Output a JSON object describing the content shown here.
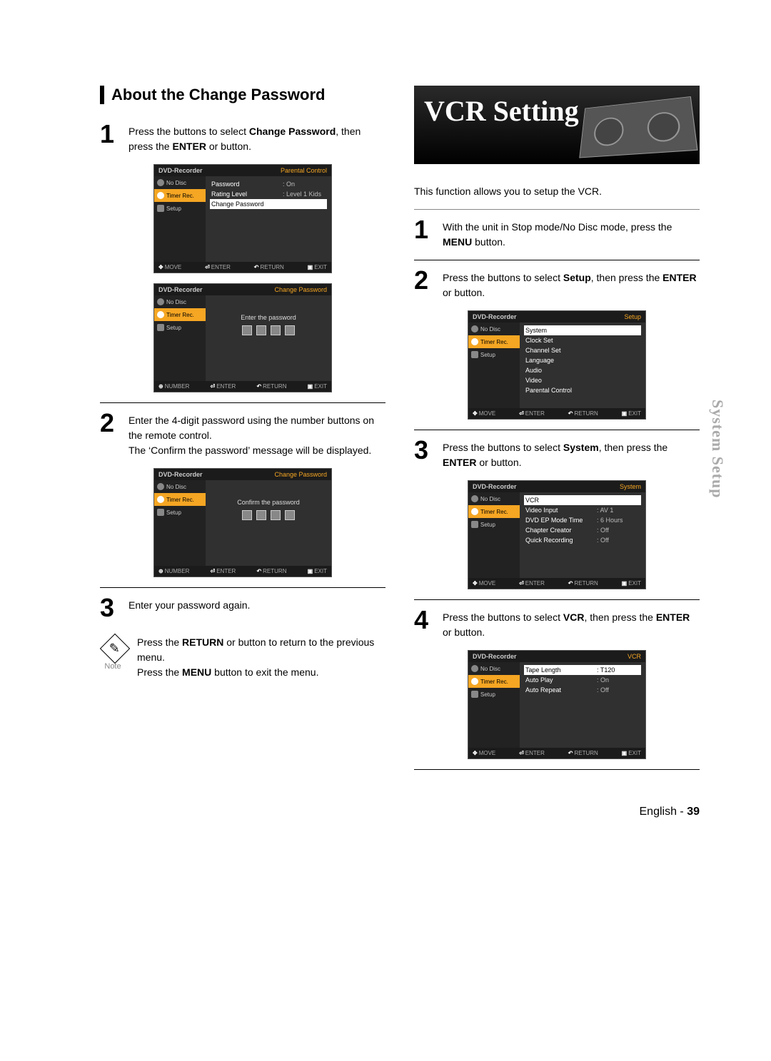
{
  "left": {
    "heading": "About the Change Password",
    "step1": {
      "t1": "Press the ",
      "t2": " buttons to select ",
      "bold1": "Change Password",
      "t3": ", then press the ",
      "bold2": "ENTER",
      "t4": " or ",
      "t5": " button."
    },
    "osd1": {
      "title": "DVD-Recorder",
      "corner": "Parental Control",
      "nodisc": "No Disc",
      "timer": "Timer Rec.",
      "setup": "Setup",
      "rows": [
        {
          "label": "Password",
          "val": ": On"
        },
        {
          "label": "Rating Level",
          "val": ": Level 1 Kids"
        },
        {
          "label": "Change Password",
          "val": ""
        }
      ],
      "footer": {
        "move": "MOVE",
        "enter": "ENTER",
        "return": "RETURN",
        "exit": "EXIT"
      }
    },
    "osd2": {
      "title": "DVD-Recorder",
      "corner": "Change Password",
      "prompt": "Enter the password",
      "footer": {
        "number": "NUMBER",
        "enter": "ENTER",
        "return": "RETURN",
        "exit": "EXIT"
      }
    },
    "step2": {
      "line1": "Enter the 4-digit password using the number buttons on the remote control.",
      "line2": "The ‘Confirm the password’ message will be displayed."
    },
    "osd3": {
      "title": "DVD-Recorder",
      "corner": "Change Password",
      "prompt": "Confirm the password",
      "footer": {
        "number": "NUMBER",
        "enter": "ENTER",
        "return": "RETURN",
        "exit": "EXIT"
      }
    },
    "step3": "Enter your password again.",
    "note": {
      "label": "Note",
      "l1a": "Press the ",
      "l1b1": "RETURN",
      "l1c": " or ",
      "l1d": " button to return to the previous menu.",
      "l2a": "Press the ",
      "l2b": "MENU",
      "l2c": " button to exit the menu."
    }
  },
  "right": {
    "banner_title": "VCR Setting",
    "intro": "This function allows you to setup the VCR.",
    "step1": {
      "a": "With the unit in Stop mode/No Disc mode, press the ",
      "b": "MENU",
      "c": " button."
    },
    "step2": {
      "a": "Press the ",
      "b": " buttons to select ",
      "c": "Setup",
      "d": ", then press the ",
      "e": "ENTER",
      "f": " or ",
      "g": " button."
    },
    "osd_setup": {
      "title": "DVD-Recorder",
      "corner": "Setup",
      "items": [
        "System",
        "Clock Set",
        "Channel Set",
        "Language",
        "Audio",
        "Video",
        "Parental Control"
      ],
      "footer": {
        "move": "MOVE",
        "enter": "ENTER",
        "return": "RETURN",
        "exit": "EXIT"
      }
    },
    "step3": {
      "a": "Press the ",
      "b": " buttons to select ",
      "c": "System",
      "d": ", then press the ",
      "e": "ENTER",
      "f": " or ",
      "g": " button."
    },
    "osd_system": {
      "title": "DVD-Recorder",
      "corner": "System",
      "rows": [
        {
          "label": "VCR",
          "val": ""
        },
        {
          "label": "Video Input",
          "val": ": AV 1"
        },
        {
          "label": "DVD EP Mode Time",
          "val": ": 6 Hours"
        },
        {
          "label": "Chapter Creator",
          "val": ": Off"
        },
        {
          "label": "Quick Recording",
          "val": ": Off"
        }
      ],
      "footer": {
        "move": "MOVE",
        "enter": "ENTER",
        "return": "RETURN",
        "exit": "EXIT"
      }
    },
    "step4": {
      "a": "Press the ",
      "b": " buttons to select ",
      "c": "VCR",
      "d": ", then press the ",
      "e": "ENTER",
      "f": " or ",
      "g": " button."
    },
    "osd_vcr": {
      "title": "DVD-Recorder",
      "corner": "VCR",
      "rows": [
        {
          "label": "Tape Length",
          "val": ": T120"
        },
        {
          "label": "Auto Play",
          "val": ": On"
        },
        {
          "label": "Auto Repeat",
          "val": ": Off"
        }
      ],
      "footer": {
        "move": "MOVE",
        "enter": "ENTER",
        "return": "RETURN",
        "exit": "EXIT"
      }
    },
    "sidebar_common": {
      "nodisc": "No Disc",
      "timer": "Timer Rec.",
      "setup": "Setup"
    }
  },
  "tab": "System Setup",
  "footer": {
    "lang": "English -",
    "page": "39"
  }
}
